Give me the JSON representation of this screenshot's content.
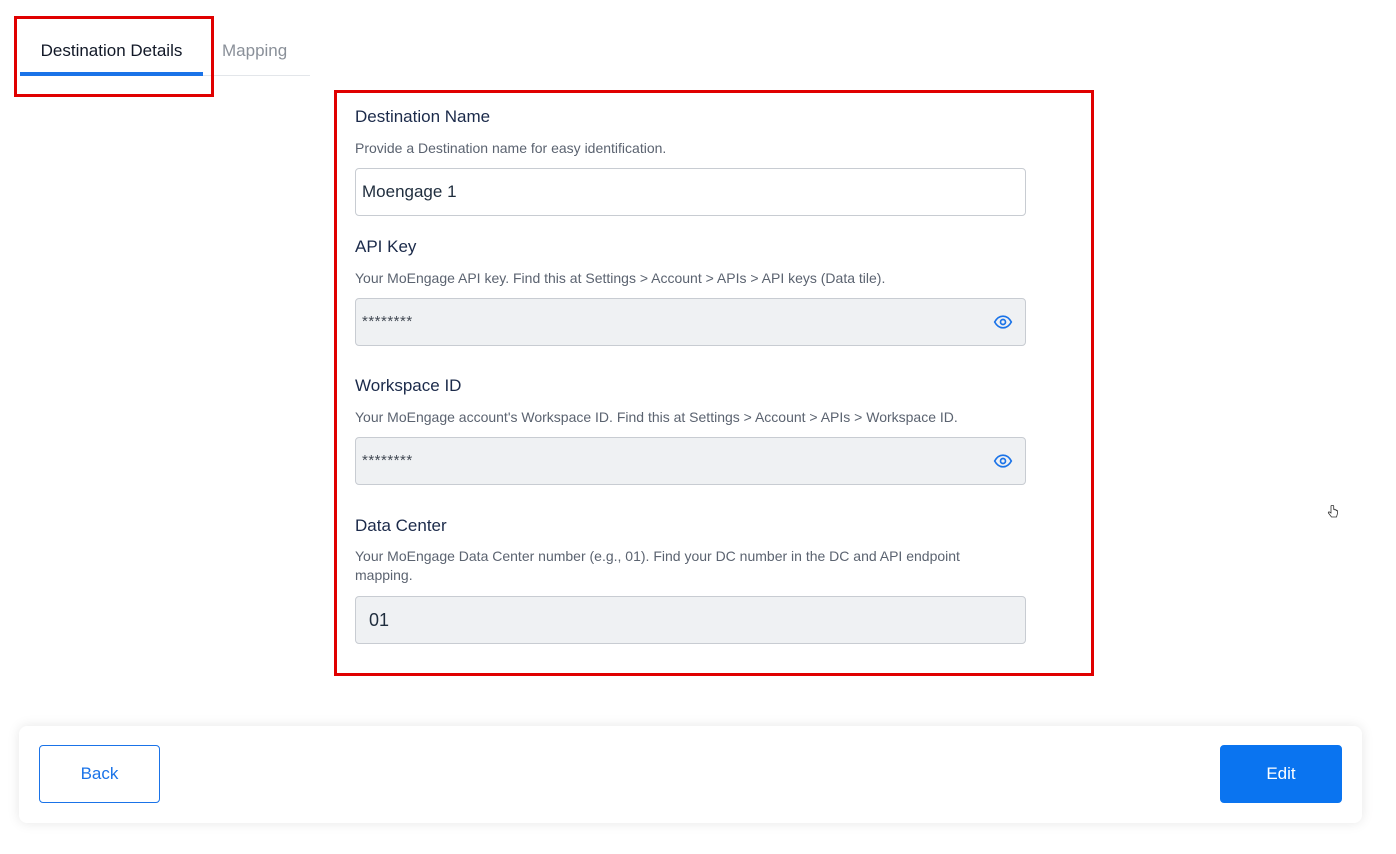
{
  "tabs": [
    {
      "label": "Destination Details",
      "active": true
    },
    {
      "label": "Mapping",
      "active": false
    }
  ],
  "form": {
    "destination_name": {
      "label": "Destination Name",
      "help": "Provide a Destination name for easy identification.",
      "value": "Moengage 1"
    },
    "api_key": {
      "label": "API Key",
      "help": "Your MoEngage API key. Find this at Settings > Account > APIs > API keys (Data tile).",
      "value": "********",
      "icon": "eye-icon"
    },
    "workspace_id": {
      "label": "Workspace ID",
      "help": "Your MoEngage account's Workspace ID. Find this at Settings > Account > APIs > Workspace ID.",
      "value": "********",
      "icon": "eye-icon"
    },
    "data_center": {
      "label": "Data Center",
      "help": "Your MoEngage Data Center number (e.g., 01). Find your DC number in the DC and API endpoint mapping.",
      "value": "01"
    }
  },
  "footer": {
    "back_label": "Back",
    "edit_label": "Edit"
  },
  "colors": {
    "accent": "#0a74f0",
    "highlight": "#e00000",
    "readonly_bg": "#eff1f3"
  }
}
